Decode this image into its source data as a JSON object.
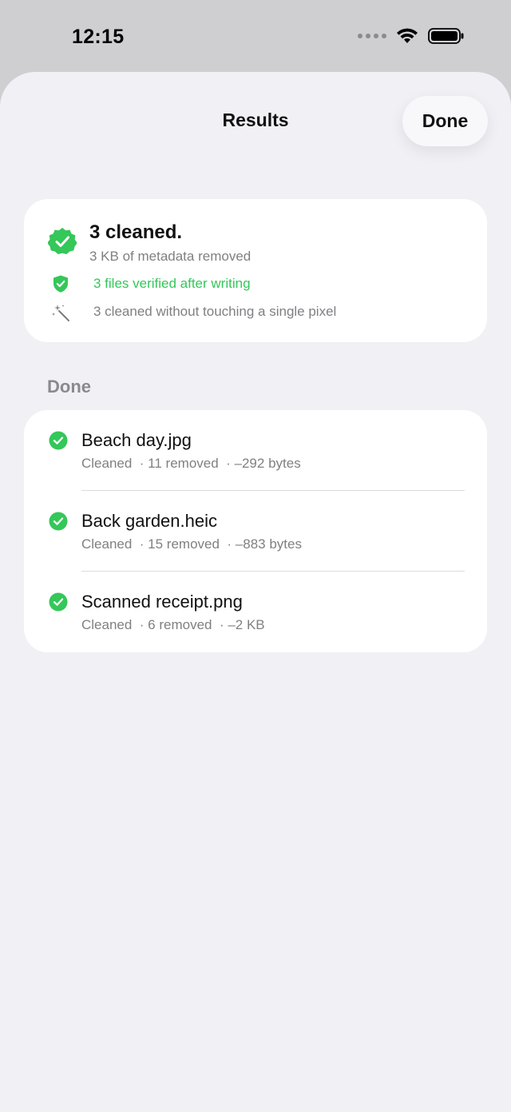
{
  "status_bar": {
    "time": "12:15"
  },
  "nav": {
    "title": "Results",
    "done_label": "Done"
  },
  "summary": {
    "title": "3 cleaned.",
    "subtitle": "3 KB of metadata removed",
    "verified_text": "3 files verified after writing",
    "pixel_text": "3 cleaned without touching a single pixel"
  },
  "section": {
    "label": "Done"
  },
  "files": [
    {
      "name": "Beach day.jpg",
      "status": "Cleaned",
      "removed": "· 11 removed",
      "size": "· –292 bytes"
    },
    {
      "name": "Back garden.heic",
      "status": "Cleaned",
      "removed": "· 15 removed",
      "size": "· –883 bytes"
    },
    {
      "name": "Scanned receipt.png",
      "status": "Cleaned",
      "removed": "· 6 removed",
      "size": "· –2 KB"
    }
  ],
  "colors": {
    "accent_green": "#34c759",
    "sheet_bg": "#f1f0f5",
    "secondary_text": "#808084"
  },
  "icons": {
    "badge": "checkmark-seal-icon",
    "verified": "checkmark-shield-icon",
    "pixel": "magic-wand-icon",
    "file_done": "checkmark-circle-icon"
  }
}
